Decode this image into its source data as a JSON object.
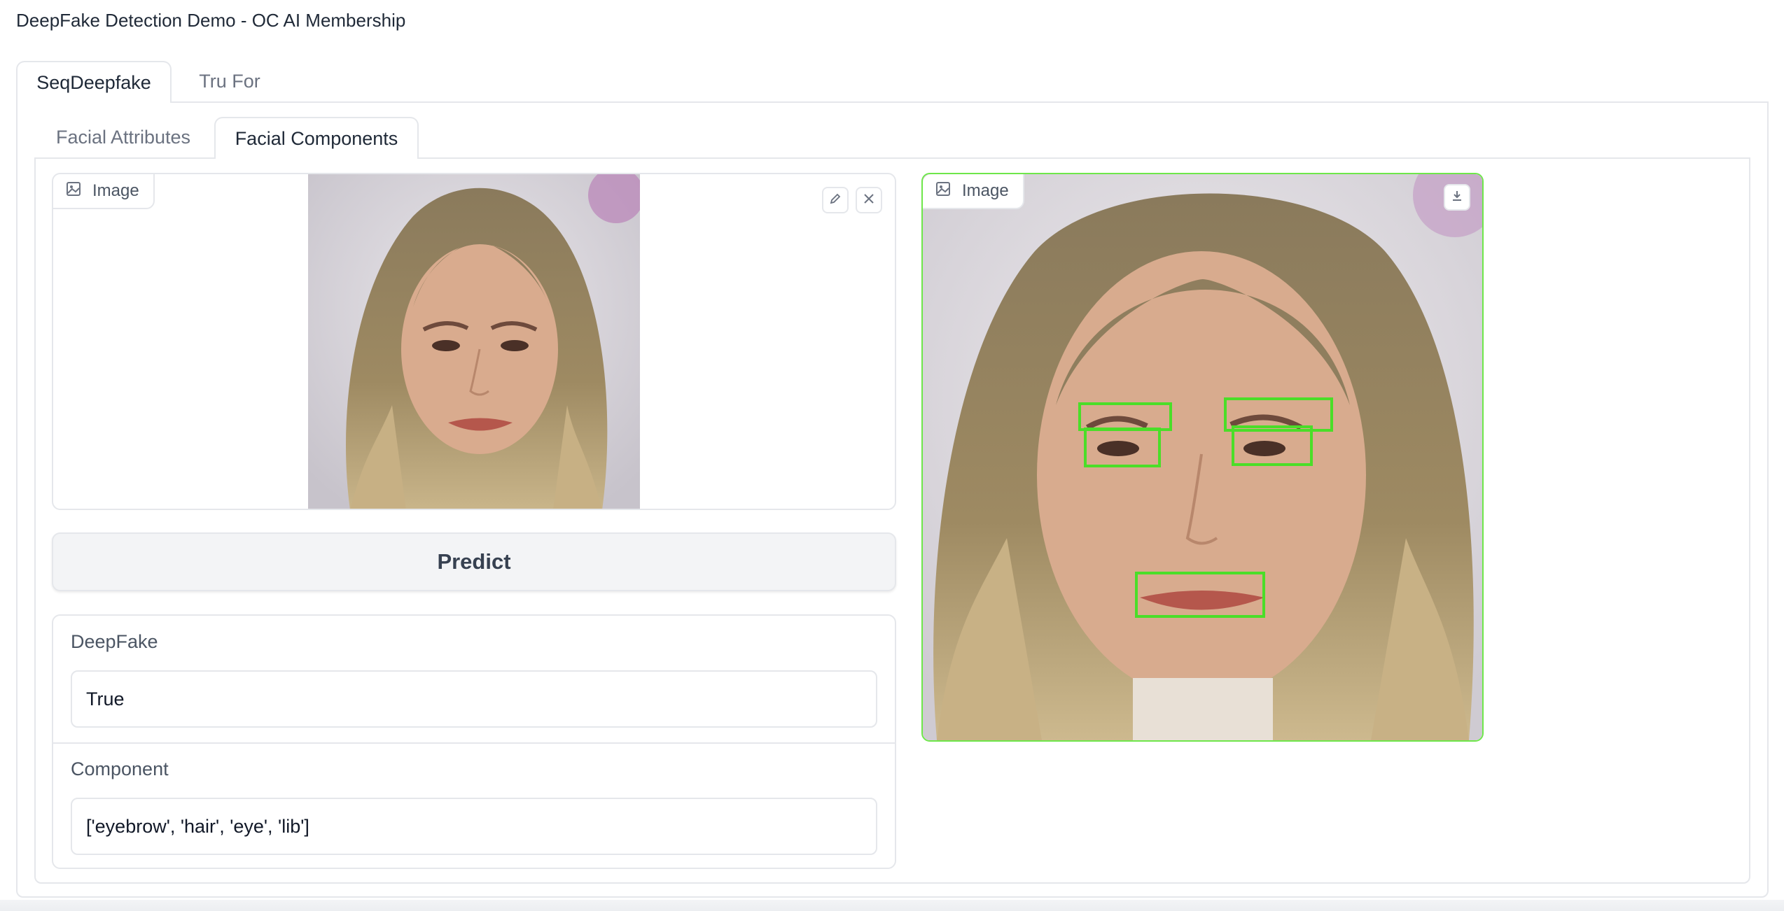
{
  "app": {
    "title": "DeepFake Detection Demo - OC AI Membership"
  },
  "outer_tabs": [
    {
      "label": "SeqDeepfake",
      "selected": true
    },
    {
      "label": "Tru For",
      "selected": false
    }
  ],
  "inner_tabs": [
    {
      "label": "Facial Attributes",
      "selected": false
    },
    {
      "label": "Facial Components",
      "selected": true
    }
  ],
  "input_image": {
    "label": "Image",
    "icon": "image-icon",
    "actions": [
      "edit-icon",
      "close-icon"
    ]
  },
  "predict": {
    "label": "Predict"
  },
  "results": {
    "deepfake_label": "DeepFake",
    "deepfake_value": "True",
    "component_label": "Component",
    "component_value": "['eyebrow', 'hair', 'eye', 'lib']"
  },
  "output_image": {
    "label": "Image",
    "icon": "image-icon",
    "actions": [
      "download-icon"
    ],
    "box_color": "#4ade28"
  },
  "colors": {
    "border": "#e5e7eb",
    "button_bg": "#f3f4f6",
    "detection": "#4ade28"
  }
}
